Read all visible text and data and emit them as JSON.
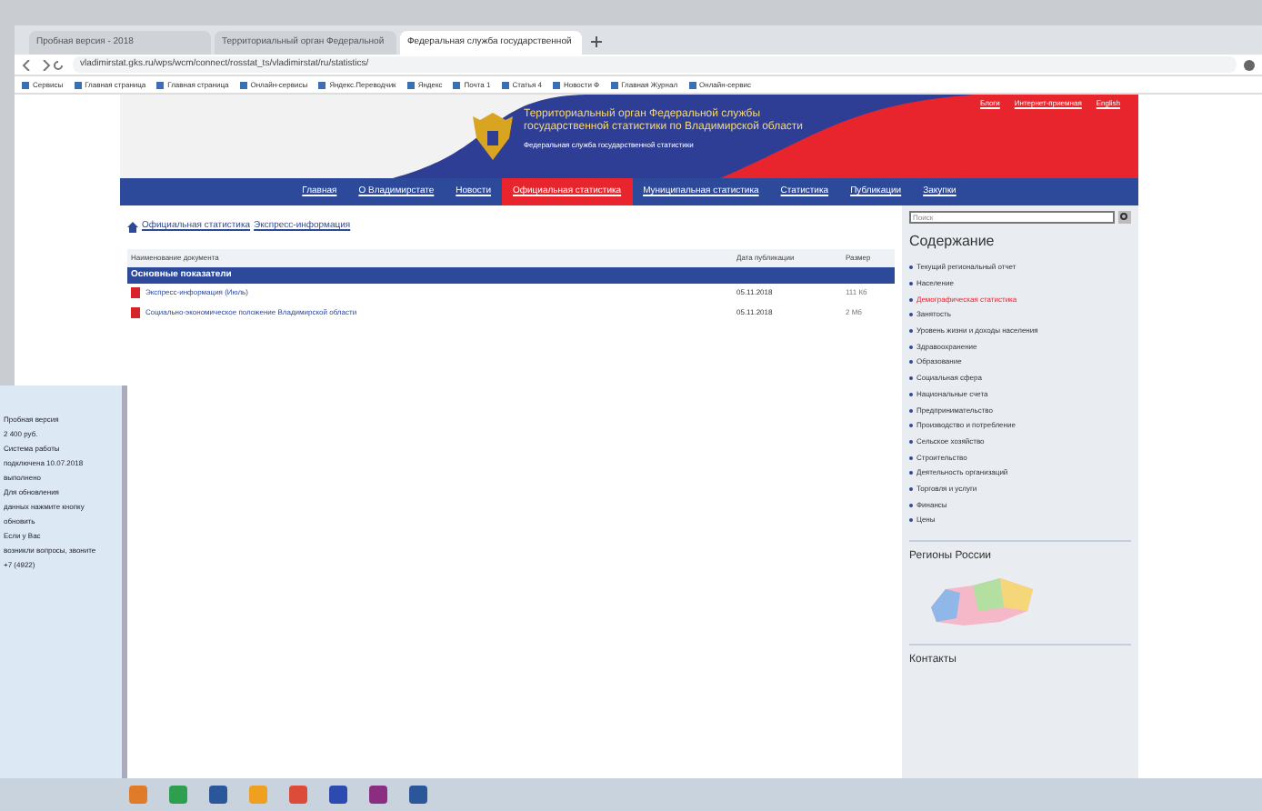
{
  "tabs": [
    {
      "label": "Пробная версия - 2018",
      "selected": false
    },
    {
      "label": "Территориальный орган Федеральной",
      "selected": false
    },
    {
      "label": "Федеральная служба государственной",
      "selected": true
    }
  ],
  "address": "vladimirstat.gks.ru/wps/wcm/connect/rosstat_ts/vladimirstat/ru/statistics/",
  "bookmarks": [
    "Сервисы",
    "Главная страница",
    "Главная страница",
    "Онлайн-сервисы",
    "Яндекс.Переводчик",
    "Яндекс",
    "Почта 1",
    "Статья 4",
    "Новости Ф",
    "Главная Журнал",
    "Онлайн-сервис"
  ],
  "header": {
    "top_links": [
      "Блоги",
      "Интернет-приемная",
      "English"
    ],
    "title": "Территориальный орган Федеральной службы государственной статистики по Владимирской области",
    "subtitle": "Федеральная служба государственной статистики"
  },
  "nav": [
    {
      "label": "Главная",
      "selected": false
    },
    {
      "label": "О Владимирстате",
      "selected": false
    },
    {
      "label": "Новости",
      "selected": false
    },
    {
      "label": "Официальная статистика",
      "selected": true
    },
    {
      "label": "Муниципальная статистика",
      "selected": false
    },
    {
      "label": "Статистика",
      "selected": false
    },
    {
      "label": "Публикации",
      "selected": false
    },
    {
      "label": "Закупки",
      "selected": false
    }
  ],
  "breadcrumbs": [
    "Официальная статистика",
    "Экспресс-информация"
  ],
  "table": {
    "columns": [
      "Наименование документа",
      "Дата публикации",
      "Размер"
    ],
    "section": "Основные показатели",
    "rows": [
      {
        "name": "Экспресс-информация (Июль)",
        "date": "05.11.2018",
        "size": "111 Кб"
      },
      {
        "name": "Социально-экономическое положение Владимирской области",
        "date": "05.11.2018",
        "size": "2 Мб"
      }
    ]
  },
  "sidebar": {
    "search_placeholder": "Поиск",
    "title": "Содержание",
    "items": [
      {
        "label": "Текущий региональный отчет",
        "selected": false
      },
      {
        "label": "Население",
        "selected": false
      },
      {
        "label": "Демографическая статистика",
        "selected": true
      },
      {
        "label": "Занятость",
        "selected": false
      },
      {
        "label": "Уровень жизни и доходы населения",
        "selected": false
      },
      {
        "label": "Здравоохранение",
        "selected": false
      },
      {
        "label": "Образование",
        "selected": false
      },
      {
        "label": "Социальная сфера",
        "selected": false
      },
      {
        "label": "Национальные счета",
        "selected": false
      },
      {
        "label": "Предпринимательство",
        "selected": false
      },
      {
        "label": "Производство и потребление",
        "selected": false
      },
      {
        "label": "Сельское хозяйство",
        "selected": false
      },
      {
        "label": "Строительство",
        "selected": false
      },
      {
        "label": "Деятельность организаций",
        "selected": false
      },
      {
        "label": "Торговля и услуги",
        "selected": false
      },
      {
        "label": "Финансы",
        "selected": false
      },
      {
        "label": "Цены",
        "selected": false
      }
    ],
    "regions_title": "Регионы России",
    "contacts_title": "Контакты"
  },
  "side_window": {
    "lines": [
      "Пробная версия",
      "2 400 руб.",
      "Система работы",
      "подключена 10.07.2018",
      "выполнено",
      "Для обновления",
      "данных нажмите кнопку",
      "обновить",
      "Если у Вас",
      "возникли вопросы, звоните",
      "+7 (4922)"
    ]
  }
}
